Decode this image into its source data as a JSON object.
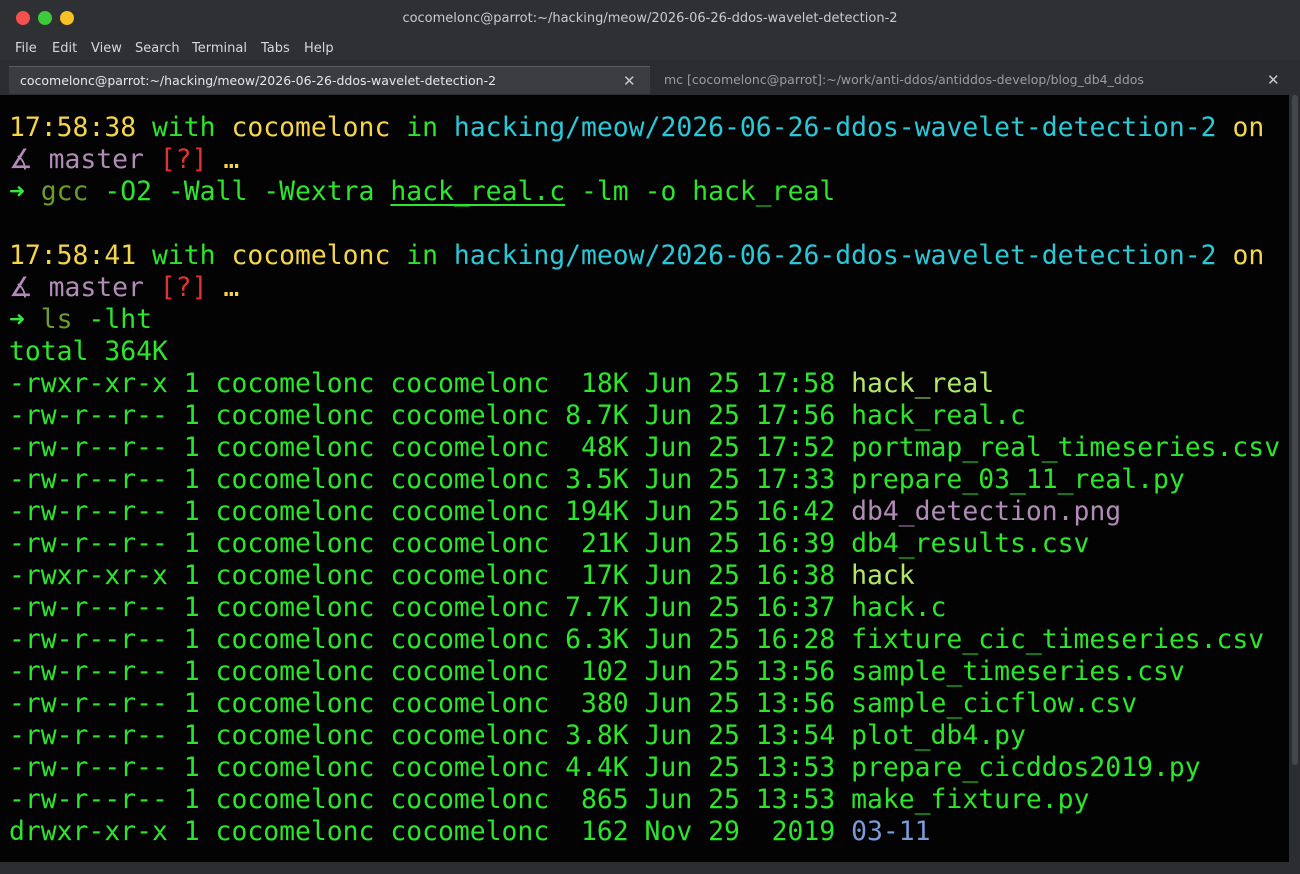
{
  "window": {
    "title": "cocomelonc@parrot:~/hacking/meow/2026-06-26-ddos-wavelet-detection-2"
  },
  "menu": [
    "File",
    "Edit",
    "View",
    "Search",
    "Terminal",
    "Tabs",
    "Help"
  ],
  "tabs": [
    {
      "label": "cocomelonc@parrot:~/hacking/meow/2026-06-26-ddos-wavelet-detection-2",
      "close": "✕"
    },
    {
      "label": "mc [cocomelonc@parrot]:~/work/anti-ddos/antiddos-develop/blog_db4_ddos",
      "close": "✕"
    }
  ],
  "colors": {
    "terminal_bg": "#030303",
    "green": "#2ee52e",
    "yellow": "#f5d54c",
    "cyan": "#2bc8d8",
    "purple": "#b28bb8",
    "red": "#e03434",
    "blue": "#7a9cd6"
  },
  "prompt1": {
    "time": "17:58:38",
    "with": "with",
    "user": "cocomelonc",
    "in": "in",
    "path": "hacking/meow/2026-06-26-ddos-wavelet-detection-2",
    "on": "on",
    "branch_icon": "∡",
    "branch": "master",
    "status": "[?]",
    "ellipsis": "…",
    "arrow": "➜",
    "cmd": "gcc",
    "args1": " -O2 -Wall -Wextra ",
    "file": "hack_real.c",
    "args2": " -lm -o hack_real"
  },
  "prompt2": {
    "time": "17:58:41",
    "with": "with",
    "user": "cocomelonc",
    "in": "in",
    "path": "hacking/meow/2026-06-26-ddos-wavelet-detection-2",
    "on": "on",
    "branch_icon": "∡",
    "branch": "master",
    "status": "[?]",
    "ellipsis": "…",
    "arrow": "➜",
    "cmd": "ls",
    "args": " -lht"
  },
  "total": "total 364K",
  "listing": [
    {
      "meta": "-rwxr-xr-x 1 cocomelonc cocomelonc  18K Jun 25 17:58 ",
      "name": "hack_real",
      "kind": "exec"
    },
    {
      "meta": "-rw-r--r-- 1 cocomelonc cocomelonc 8.7K Jun 25 17:56 ",
      "name": "hack_real.c",
      "kind": "plain"
    },
    {
      "meta": "-rw-r--r-- 1 cocomelonc cocomelonc  48K Jun 25 17:52 ",
      "name": "portmap_real_timeseries.csv",
      "kind": "plain"
    },
    {
      "meta": "-rw-r--r-- 1 cocomelonc cocomelonc 3.5K Jun 25 17:33 ",
      "name": "prepare_03_11_real.py",
      "kind": "plain"
    },
    {
      "meta": "-rw-r--r-- 1 cocomelonc cocomelonc 194K Jun 25 16:42 ",
      "name": "db4_detection.png",
      "kind": "img"
    },
    {
      "meta": "-rw-r--r-- 1 cocomelonc cocomelonc  21K Jun 25 16:39 ",
      "name": "db4_results.csv",
      "kind": "plain"
    },
    {
      "meta": "-rwxr-xr-x 1 cocomelonc cocomelonc  17K Jun 25 16:38 ",
      "name": "hack",
      "kind": "exec"
    },
    {
      "meta": "-rw-r--r-- 1 cocomelonc cocomelonc 7.7K Jun 25 16:37 ",
      "name": "hack.c",
      "kind": "plain"
    },
    {
      "meta": "-rw-r--r-- 1 cocomelonc cocomelonc 6.3K Jun 25 16:28 ",
      "name": "fixture_cic_timeseries.csv",
      "kind": "plain"
    },
    {
      "meta": "-rw-r--r-- 1 cocomelonc cocomelonc  102 Jun 25 13:56 ",
      "name": "sample_timeseries.csv",
      "kind": "plain"
    },
    {
      "meta": "-rw-r--r-- 1 cocomelonc cocomelonc  380 Jun 25 13:56 ",
      "name": "sample_cicflow.csv",
      "kind": "plain"
    },
    {
      "meta": "-rw-r--r-- 1 cocomelonc cocomelonc 3.8K Jun 25 13:54 ",
      "name": "plot_db4.py",
      "kind": "plain"
    },
    {
      "meta": "-rw-r--r-- 1 cocomelonc cocomelonc 4.4K Jun 25 13:53 ",
      "name": "prepare_cicddos2019.py",
      "kind": "plain"
    },
    {
      "meta": "-rw-r--r-- 1 cocomelonc cocomelonc  865 Jun 25 13:53 ",
      "name": "make_fixture.py",
      "kind": "plain"
    },
    {
      "meta": "drwxr-xr-x 1 cocomelonc cocomelonc  162 Nov 29  2019 ",
      "name": "03-11",
      "kind": "dir"
    }
  ]
}
